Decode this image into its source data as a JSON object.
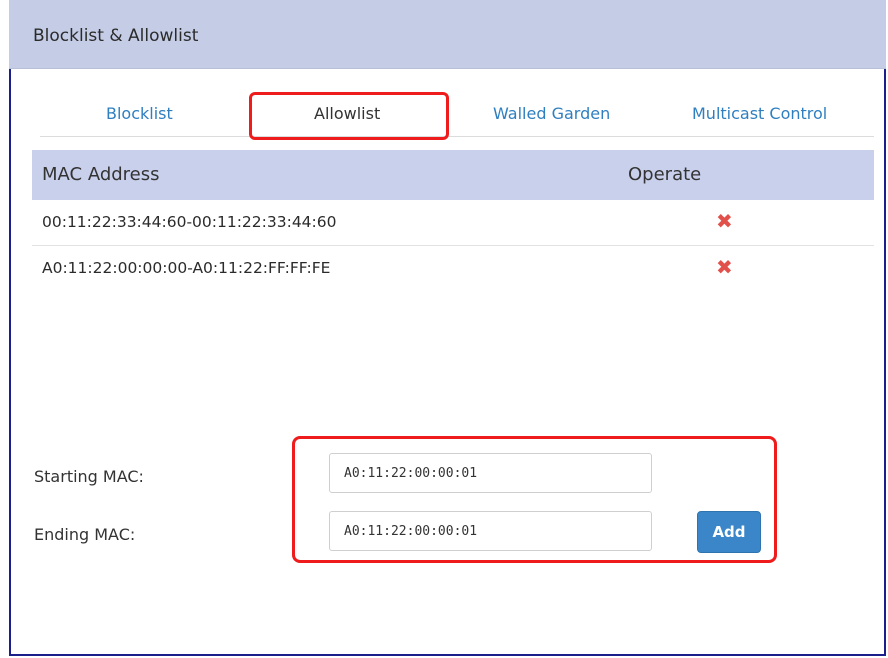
{
  "panel": {
    "title": "Blocklist & Allowlist"
  },
  "tabs": [
    {
      "label": "Blocklist"
    },
    {
      "label": "Allowlist"
    },
    {
      "label": "Walled Garden"
    },
    {
      "label": "Multicast Control"
    }
  ],
  "table": {
    "columns": [
      "MAC Address",
      "Operate"
    ],
    "rows": [
      {
        "mac": "00:11:22:33:44:60-00:11:22:33:44:60",
        "operate_icon": "delete-x-icon"
      },
      {
        "mac": "A0:11:22:00:00:00-A0:11:22:FF:FF:FE",
        "operate_icon": "delete-x-icon"
      }
    ]
  },
  "form": {
    "starting_label": "Starting MAC:",
    "starting_value": "A0:11:22:00:00:01",
    "ending_label": "Ending MAC:",
    "ending_value": "A0:11:22:00:00:01",
    "add_label": "Add"
  },
  "colors": {
    "header_bg": "#c5cde6",
    "tab_link": "#2f7fc0",
    "delete_icon": "#e2504b",
    "primary_button": "#3a86c8",
    "highlight": "#ee1c1c"
  }
}
